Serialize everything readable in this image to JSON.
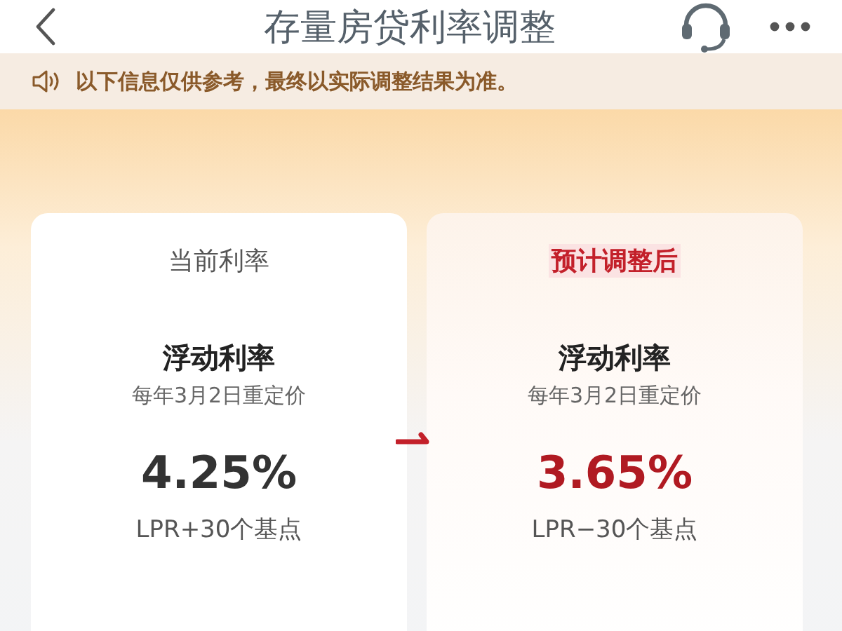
{
  "header": {
    "title": "存量房贷利率调整"
  },
  "notice": {
    "text": "以下信息仅供参考，最终以实际调整结果为准。"
  },
  "cards": [
    {
      "kind": "current",
      "title": "当前利率",
      "rate_type": "浮动利率",
      "repricing": "每年3月2日重定价",
      "rate": "4.25%",
      "basis": "LPR+30个基点"
    },
    {
      "kind": "adjusted",
      "title": "预计调整后",
      "rate_type": "浮动利率",
      "repricing": "每年3月2日重定价",
      "rate": "3.65%",
      "basis": "LPR−30个基点"
    }
  ]
}
